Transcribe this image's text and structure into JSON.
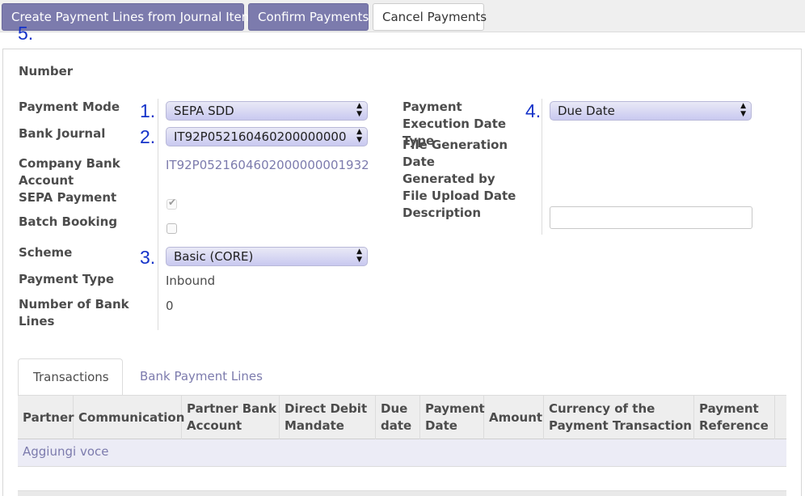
{
  "toolbar": {
    "create_lines": "Create Payment Lines from Journal Items",
    "confirm": "Confirm Payments",
    "cancel": "Cancel Payments"
  },
  "markers": {
    "m1": "1.",
    "m2": "2.",
    "m3": "3.",
    "m4": "4.",
    "m5": "5."
  },
  "form": {
    "number_label": "Number",
    "payment_mode_label": "Payment Mode",
    "payment_mode_value": "SEPA SDD",
    "bank_journal_label": "Bank Journal",
    "bank_journal_value": "IT92P052160460200000000",
    "company_bank_account_label": "Company Bank Account",
    "company_bank_account_value": "IT92P0521604602000000001932",
    "sepa_payment_label": "SEPA Payment",
    "sepa_payment_checked": true,
    "batch_booking_label": "Batch Booking",
    "batch_booking_checked": false,
    "scheme_label": "Scheme",
    "scheme_value": "Basic (CORE)",
    "payment_type_label": "Payment Type",
    "payment_type_value": "Inbound",
    "number_bank_lines_label": "Number of Bank Lines",
    "number_bank_lines_value": "0",
    "exec_date_type_label": "Payment Execution Date Type",
    "exec_date_type_value": "Due Date",
    "file_generation_label": "File Generation Date",
    "generated_by_label": "Generated by",
    "file_upload_label": "File Upload Date",
    "description_label": "Description",
    "description_value": ""
  },
  "tabs": {
    "transactions": "Transactions",
    "bank_payment_lines": "Bank Payment Lines"
  },
  "table": {
    "columns": [
      "Partner",
      "Communication",
      "Partner Bank Account",
      "Direct Debit Mandate",
      "Due date",
      "Payment Date",
      "Amount",
      "Currency of the Payment Transaction",
      "Payment Reference"
    ],
    "add_line": "Aggiungi voce"
  },
  "colors": {
    "accent": "#7c7bad",
    "marker": "#1533c9"
  }
}
